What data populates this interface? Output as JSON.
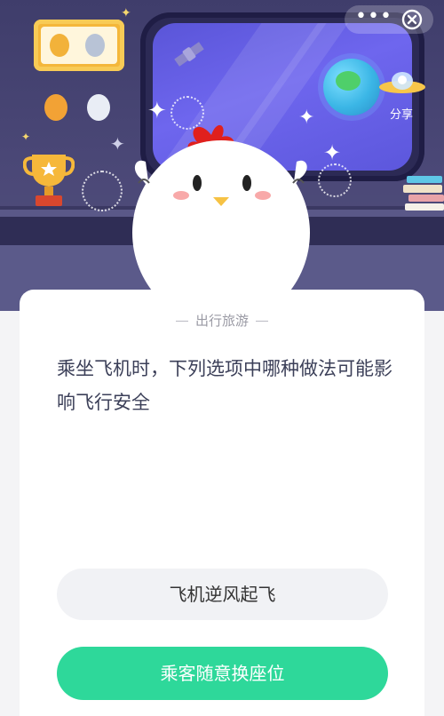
{
  "header": {
    "share_label": "分享",
    "more_icon": "more-dots-icon",
    "close_icon": "close-circle-icon"
  },
  "card": {
    "category": "出行旅游",
    "question": "乘坐飞机时，下列选项中哪种做法可能影响飞行安全"
  },
  "options": [
    {
      "label": "飞机逆风起飞"
    },
    {
      "label": "乘客随意换座位"
    }
  ],
  "colors": {
    "accent": "#2ed89a",
    "scene_bg": "#4b4877",
    "window_glass": "#6e66ee",
    "text": "#3b3f58"
  }
}
